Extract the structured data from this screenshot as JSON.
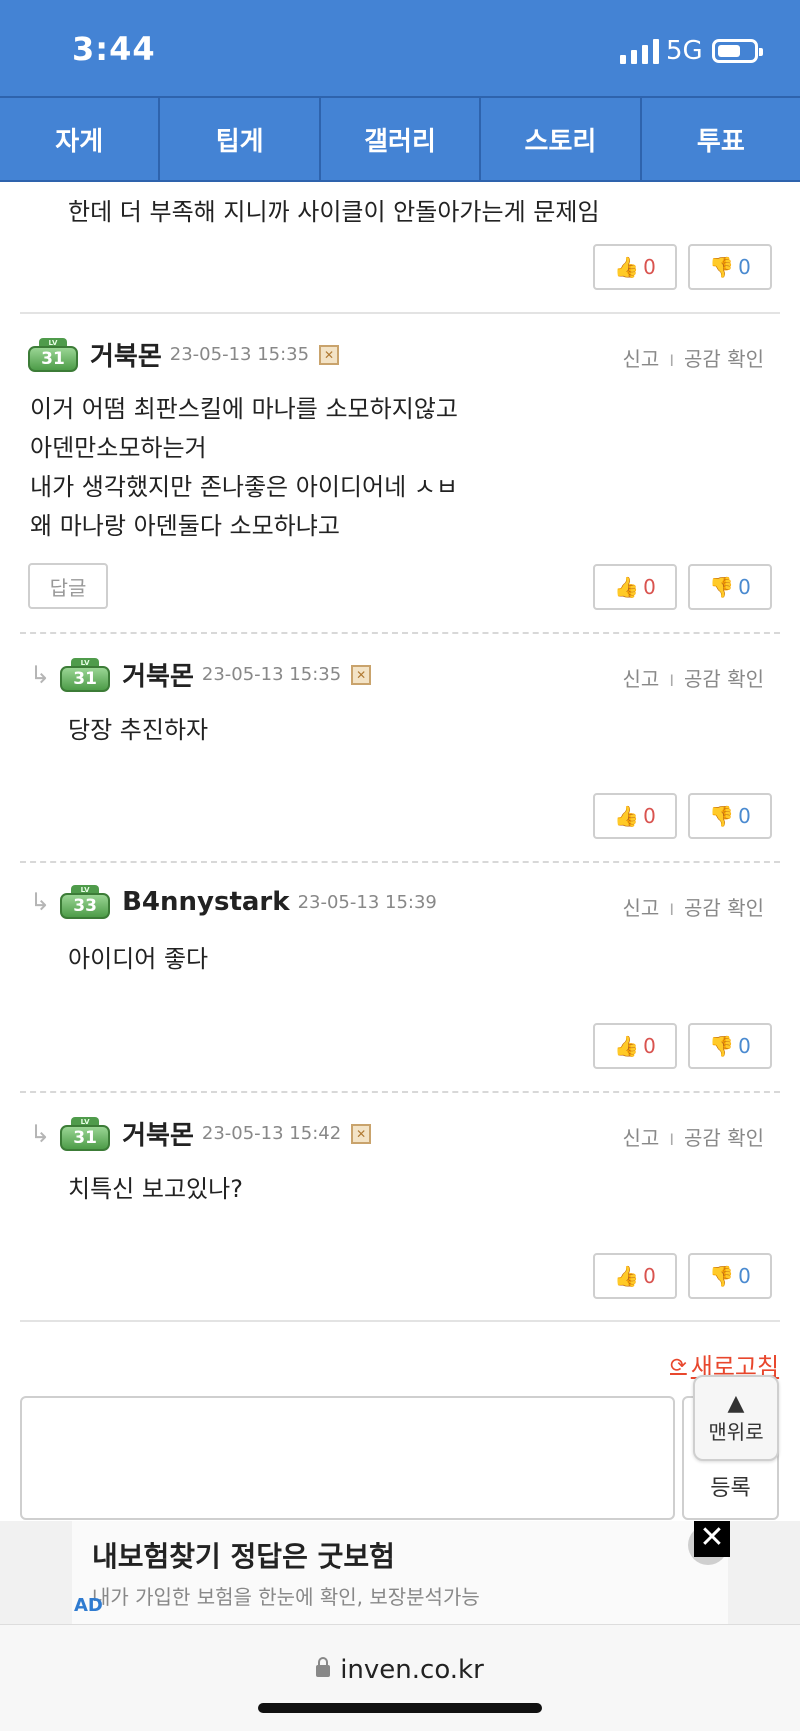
{
  "status_bar": {
    "time": "3:44",
    "network": "5G"
  },
  "tabs": [
    "자게",
    "팁게",
    "갤러리",
    "스토리",
    "투표"
  ],
  "partial_comment": {
    "text": "한데 더 부족해 지니까 사이클이 안돌아가는게 문제임",
    "up": "0",
    "down": "0"
  },
  "actions": {
    "report": "신고",
    "sep": "I",
    "likes": "공감 확인"
  },
  "reply_label": "답글",
  "comments": [
    {
      "level": "31",
      "nick": "거북몬",
      "date": "23-05-13 15:35",
      "lines": [
        "이거 어떰 최판스킬에 마나를 소모하지않고",
        "아덴만소모하는거",
        "내가 생각했지만 존나좋은 아이디어네 ㅅㅂ",
        "왜 마나랑 아덴둘다 소모하냐고"
      ],
      "up": "0",
      "down": "0"
    },
    {
      "level": "31",
      "nick": "거북몬",
      "date": "23-05-13 15:35",
      "lines": [
        "당장 추진하자"
      ],
      "up": "0",
      "down": "0"
    },
    {
      "level": "33",
      "nick": "B4nnystark",
      "date": "23-05-13 15:39",
      "lines": [
        "아이디어 좋다"
      ],
      "up": "0",
      "down": "0"
    },
    {
      "level": "31",
      "nick": "거북몬",
      "date": "23-05-13 15:42",
      "lines": [
        "치특신 보고있나?"
      ],
      "up": "0",
      "down": "0"
    }
  ],
  "refresh_label": "새로고침",
  "submit_label": "등록",
  "to_top_label": "맨위로",
  "ad": {
    "title": "내보험찾기 정답은 굿보험",
    "subtitle": "내가 가입한 보험을 한눈에 확인, 보장분석가능",
    "tag": "AD"
  },
  "browser": {
    "url": "inven.co.kr"
  }
}
